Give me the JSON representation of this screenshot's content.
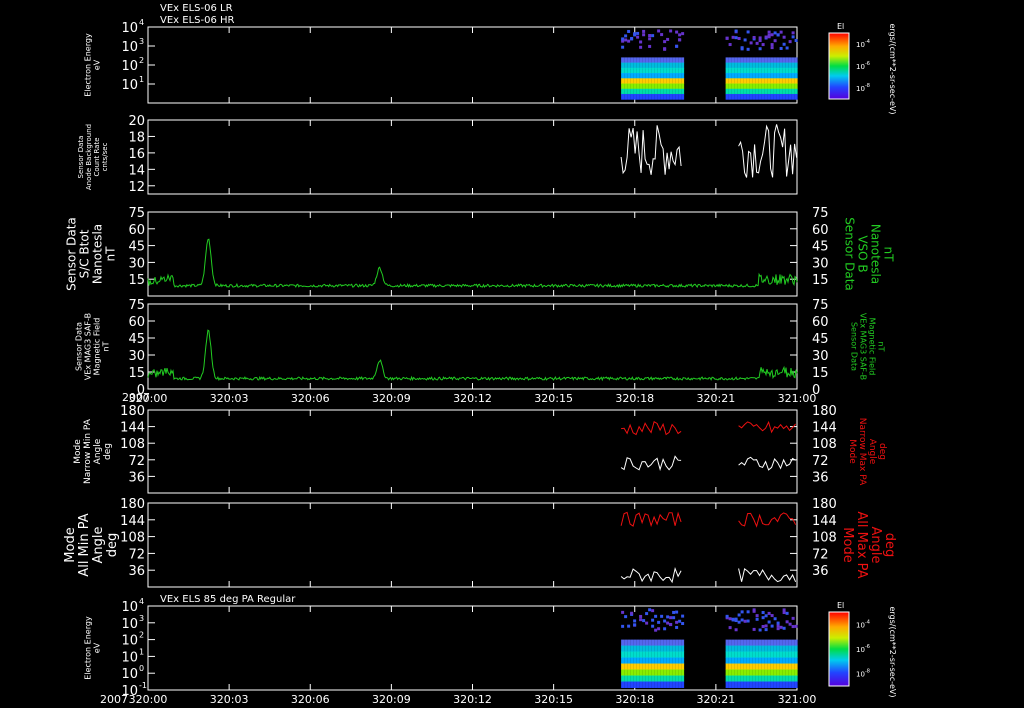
{
  "headers": {
    "top_line1": "VEx ELS-06 LR",
    "top_line2": "VEx ELS-06 HR",
    "bottom": "VEx ELS 85 deg PA Regular"
  },
  "year_label": "2007",
  "time_ticks": [
    "320:00",
    "320:03",
    "320:06",
    "320:09",
    "320:12",
    "320:15",
    "320:18",
    "320:21",
    "321:00"
  ],
  "chart_data": [
    {
      "type": "heatmap",
      "ylabel_lines": [
        "Electron Energy",
        "eV"
      ],
      "yscale": "log",
      "ytick_labels": [
        [
          "10",
          "4"
        ],
        [
          "10",
          "3"
        ],
        [
          "10",
          "2"
        ],
        [
          "10",
          "1"
        ]
      ],
      "ytick_values": [
        10000,
        1000,
        100,
        10
      ],
      "ylim": [
        1,
        10000
      ],
      "colorbar": {
        "title": "El",
        "unit": "ergs/(cm**2-sr-sec-eV)",
        "ticks": [
          [
            "10",
            "-4"
          ],
          [
            "10",
            "-6"
          ],
          [
            "10",
            "-8"
          ]
        ]
      },
      "data_intervals_time": [
        [
          "320:17.5",
          "320:19.5"
        ],
        [
          "320:21.5",
          "321:00"
        ]
      ]
    },
    {
      "type": "line",
      "ylabel_lines": [
        "Sensor Data",
        "Anode Background",
        "Count Rate",
        "cnts/sec"
      ],
      "yticks": [
        "20",
        "18",
        "16",
        "14",
        "12"
      ],
      "ytick_values": [
        20,
        18,
        16,
        14,
        12
      ],
      "ylim": [
        11,
        20
      ],
      "series_color": "#ffffff",
      "data_intervals_time": [
        [
          "320:17.5",
          "320:19.5"
        ],
        [
          "320:21.5",
          "321:00"
        ]
      ]
    },
    {
      "type": "line",
      "ylabel_lines": [
        "Sensor Data",
        "S/C Btot",
        "Nanotesla",
        "nT"
      ],
      "right_label_lines": [
        "Sensor Data",
        "VSO B",
        "Nanotesla",
        "nT"
      ],
      "yticks": [
        "75",
        "60",
        "45",
        "30",
        "15"
      ],
      "ytick_values": [
        75,
        60,
        45,
        30,
        15
      ],
      "ylim": [
        0,
        75
      ],
      "series_color": "#22cc22",
      "baseline_nT": 8,
      "peaks": [
        {
          "time": "320:01.8",
          "value": 50
        },
        {
          "time": "320:07.9",
          "value": 24
        }
      ]
    },
    {
      "type": "line",
      "ylabel_lines": [
        "Sensor Data",
        "VEx MAG3 SAF-B",
        "Magnetic Field",
        "nT"
      ],
      "right_label_lines": [
        "Sensor Data",
        "VEx MAG3 SAF-B",
        "Magnetic Field",
        "nT"
      ],
      "yticks": [
        "75",
        "60",
        "45",
        "30",
        "15",
        "0"
      ],
      "ytick_values": [
        75,
        60,
        45,
        30,
        15,
        0
      ],
      "ylim": [
        0,
        75
      ],
      "series_color": "#22cc22",
      "baseline_nT": 8,
      "peaks": [
        {
          "time": "320:01.8",
          "value": 50
        },
        {
          "time": "320:07.9",
          "value": 24
        }
      ]
    },
    {
      "type": "line",
      "ylabel_lines": [
        "Mode",
        "Narrow Min PA",
        "Angle",
        "deg"
      ],
      "right_label_lines": [
        "Mode",
        "Narrow Max PA",
        "Angle",
        "deg"
      ],
      "yticks": [
        "180",
        "144",
        "108",
        "72",
        "36"
      ],
      "ytick_values": [
        180,
        144,
        108,
        72,
        36
      ],
      "ylim": [
        0,
        180
      ],
      "series": [
        {
          "name": "Narrow Min PA",
          "color": "#ffffff",
          "level_deg": 65
        },
        {
          "name": "Narrow Max PA",
          "color": "#ee1111",
          "level_deg": 140
        }
      ]
    },
    {
      "type": "line",
      "ylabel_lines": [
        "Mode",
        "All Min PA",
        "Angle",
        "deg"
      ],
      "right_label_lines": [
        "Mode",
        "All Max PA",
        "Angle",
        "deg"
      ],
      "yticks": [
        "180",
        "144",
        "108",
        "72",
        "36"
      ],
      "ytick_values": [
        180,
        144,
        108,
        72,
        36
      ],
      "ylim": [
        0,
        180
      ],
      "series": [
        {
          "name": "All Min PA",
          "color": "#ffffff",
          "level_deg": 25
        },
        {
          "name": "All Max PA",
          "color": "#ee1111",
          "level_deg": 145
        }
      ]
    },
    {
      "type": "heatmap",
      "ylabel_lines": [
        "Electron Energy",
        "eV"
      ],
      "yscale": "log",
      "ytick_labels": [
        [
          "10",
          "4"
        ],
        [
          "10",
          "3"
        ],
        [
          "10",
          "2"
        ],
        [
          "10",
          "1"
        ],
        [
          "10",
          "0"
        ],
        [
          "10",
          "-1"
        ]
      ],
      "ytick_values": [
        10000,
        1000,
        100,
        10,
        1,
        0.1
      ],
      "ylim": [
        0.1,
        10000
      ],
      "colorbar": {
        "title": "El",
        "unit": "ergs/(cm**2-sr-sec-eV)",
        "ticks": [
          [
            "10",
            "-4"
          ],
          [
            "10",
            "-6"
          ],
          [
            "10",
            "-8"
          ]
        ]
      },
      "data_intervals_time": [
        [
          "320:17.5",
          "320:19.5"
        ],
        [
          "320:21.5",
          "321:00"
        ]
      ]
    }
  ]
}
